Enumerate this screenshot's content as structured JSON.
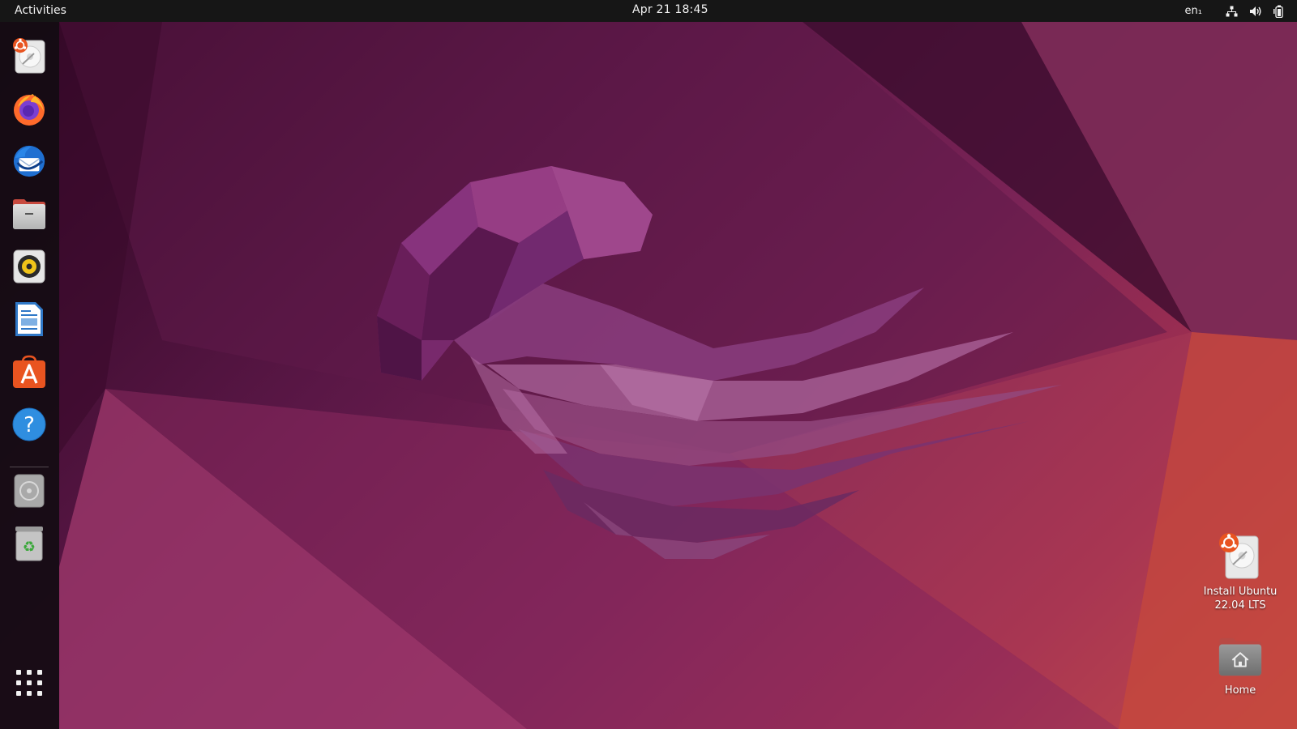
{
  "topbar": {
    "activities_label": "Activities",
    "clock": "Apr 21  18:45",
    "language": "en₁"
  },
  "dock": {
    "items": [
      {
        "name": "Install Ubuntu",
        "icon": "install-ubuntu-icon"
      },
      {
        "name": "Firefox",
        "icon": "firefox-icon"
      },
      {
        "name": "Thunderbird",
        "icon": "thunderbird-icon"
      },
      {
        "name": "Files",
        "icon": "files-icon"
      },
      {
        "name": "Rhythmbox",
        "icon": "rhythmbox-icon"
      },
      {
        "name": "LibreOffice Writer",
        "icon": "writer-icon"
      },
      {
        "name": "Ubuntu Software",
        "icon": "software-icon"
      },
      {
        "name": "Help",
        "icon": "help-icon"
      },
      {
        "name": "CD Drive",
        "icon": "cd-drive-icon"
      },
      {
        "name": "Trash",
        "icon": "trash-icon"
      }
    ],
    "show_apps_icon": "apps-grid-icon"
  },
  "desktop": {
    "items": [
      {
        "label_line1": "Install Ubuntu",
        "label_line2": "22.04 LTS",
        "icon": "install-ubuntu-icon"
      },
      {
        "label_line1": "Home",
        "icon": "home-folder-icon"
      }
    ]
  },
  "colors": {
    "topbar": "#161616",
    "dock": "#140c12",
    "wallpaper_dark": "#2a0520",
    "wallpaper_mid": "#7a2356",
    "wallpaper_warm": "#d9553e",
    "ubuntu_orange": "#e95420"
  }
}
